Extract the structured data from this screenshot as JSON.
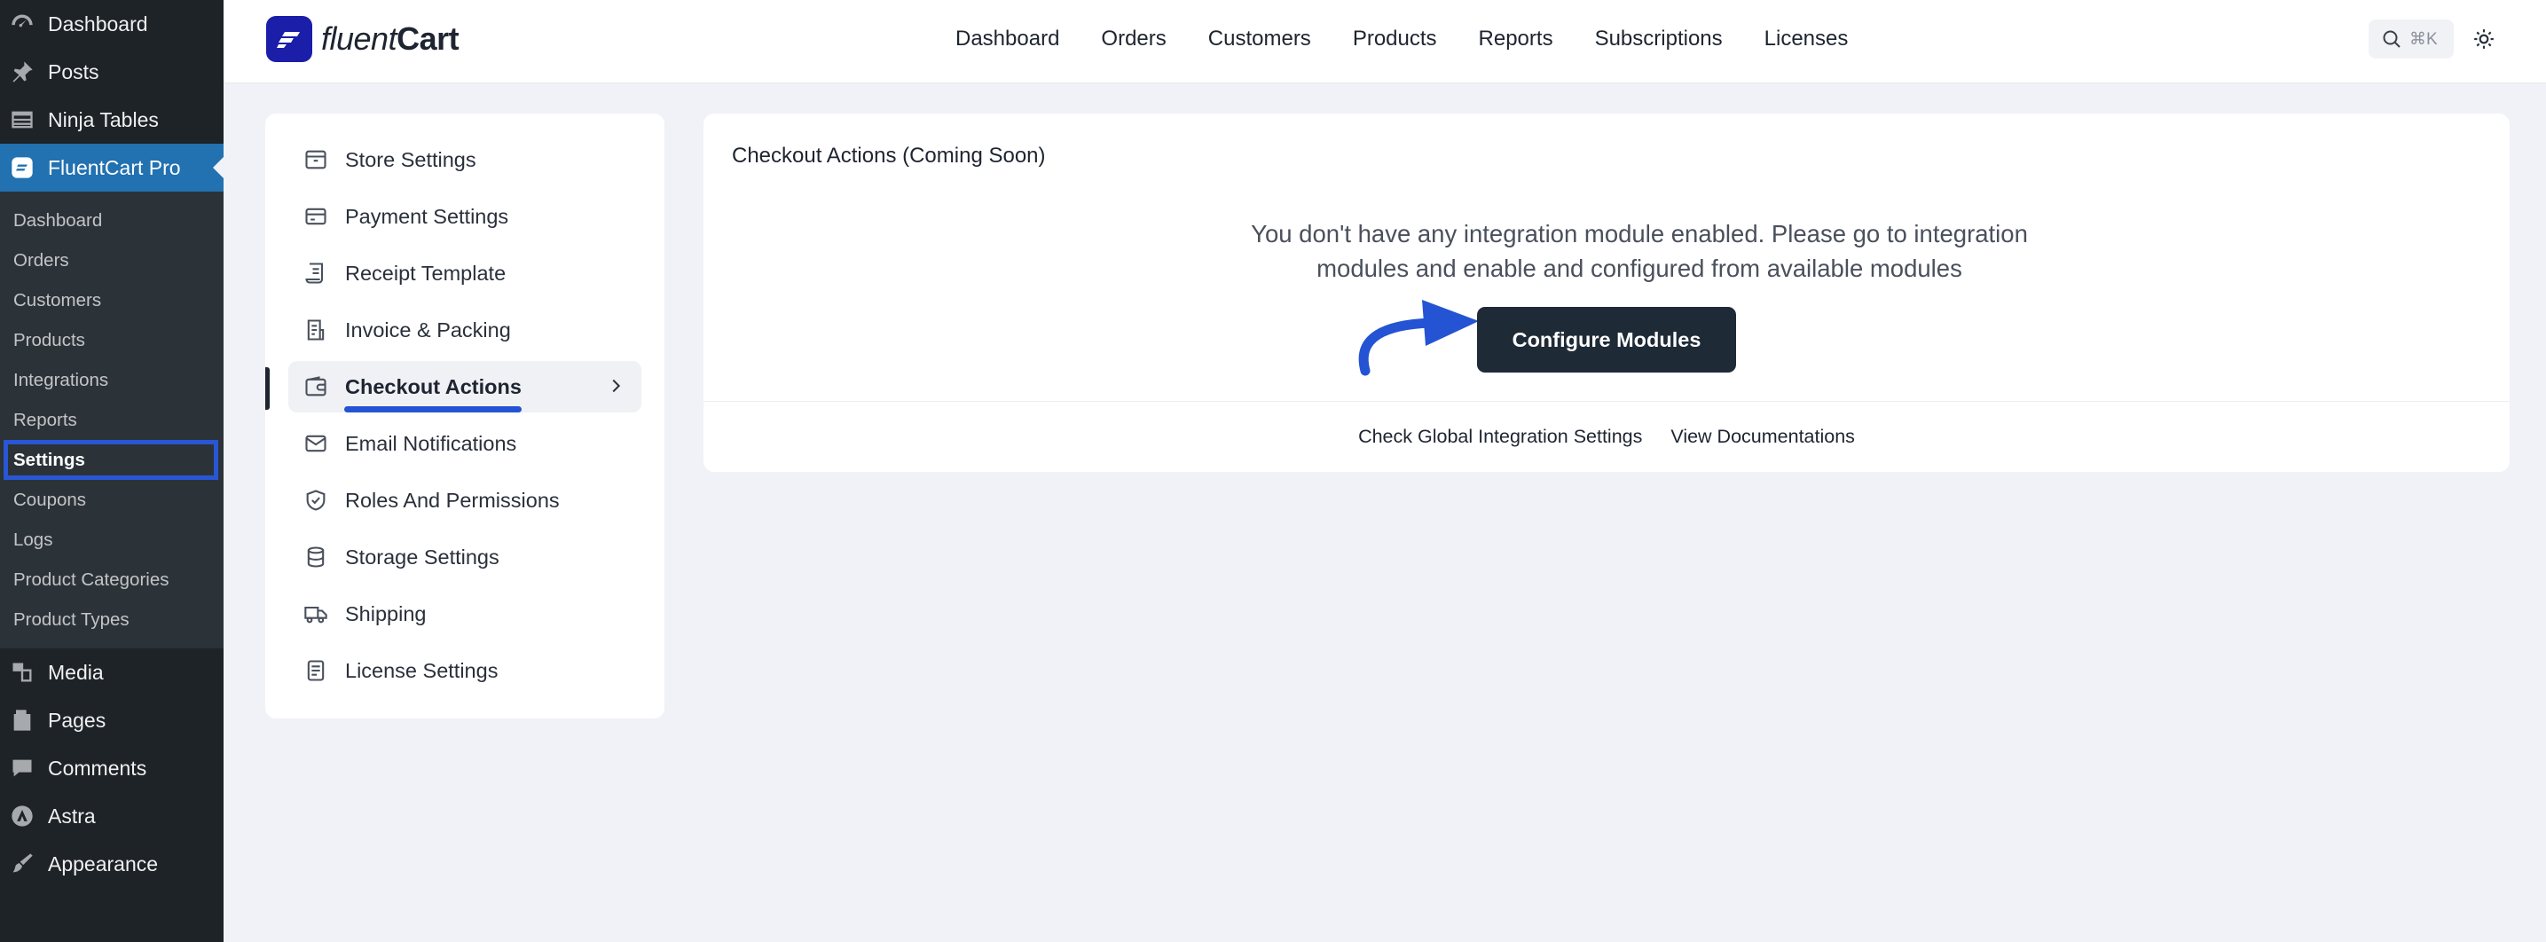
{
  "wp_sidebar": {
    "top_items": [
      {
        "label": "Dashboard",
        "icon": "dashboard-icon"
      },
      {
        "label": "Posts",
        "icon": "pin-icon"
      },
      {
        "label": "Ninja Tables",
        "icon": "table-icon"
      },
      {
        "label": "FluentCart Pro",
        "icon": "fluentcart-icon"
      }
    ],
    "sub_items": [
      "Dashboard",
      "Orders",
      "Customers",
      "Products",
      "Integrations",
      "Reports",
      "Settings",
      "Coupons",
      "Logs",
      "Product Categories",
      "Product Types"
    ],
    "bottom_items": [
      {
        "label": "Media",
        "icon": "media-icon"
      },
      {
        "label": "Pages",
        "icon": "pages-icon"
      },
      {
        "label": "Comments",
        "icon": "comments-icon"
      },
      {
        "label": "Astra",
        "icon": "astra-icon"
      },
      {
        "label": "Appearance",
        "icon": "appearance-icon"
      }
    ]
  },
  "header": {
    "brand_part1": "fluent",
    "brand_part2": "Cart",
    "nav": [
      "Dashboard",
      "Orders",
      "Customers",
      "Products",
      "Reports",
      "Subscriptions",
      "Licenses"
    ],
    "search_shortcut": "⌘K"
  },
  "settings_menu": [
    {
      "label": "Store Settings",
      "icon": "store-icon"
    },
    {
      "label": "Payment Settings",
      "icon": "card-icon"
    },
    {
      "label": "Receipt Template",
      "icon": "receipt-icon"
    },
    {
      "label": "Invoice & Packing",
      "icon": "invoice-icon"
    },
    {
      "label": "Checkout Actions",
      "icon": "wallet-icon"
    },
    {
      "label": "Email Notifications",
      "icon": "mail-icon"
    },
    {
      "label": "Roles And Permissions",
      "icon": "shield-icon"
    },
    {
      "label": "Storage Settings",
      "icon": "database-icon"
    },
    {
      "label": "Shipping",
      "icon": "truck-icon"
    },
    {
      "label": "License Settings",
      "icon": "document-icon"
    }
  ],
  "main": {
    "title": "Checkout Actions (Coming Soon)",
    "message_line1": "You don't have any integration module enabled. Please go to integration",
    "message_line2": "modules and enable and configured from available modules",
    "configure_label": "Configure Modules",
    "footer_link1": "Check Global Integration Settings",
    "footer_link2": "View Documentations"
  },
  "colors": {
    "wp_sidebar_bg": "#1d2327",
    "wp_active_bg": "#2271b1",
    "highlight_blue": "#2453d3",
    "brand_blue": "#1a1ea8",
    "button_dark": "#1f2a37"
  }
}
